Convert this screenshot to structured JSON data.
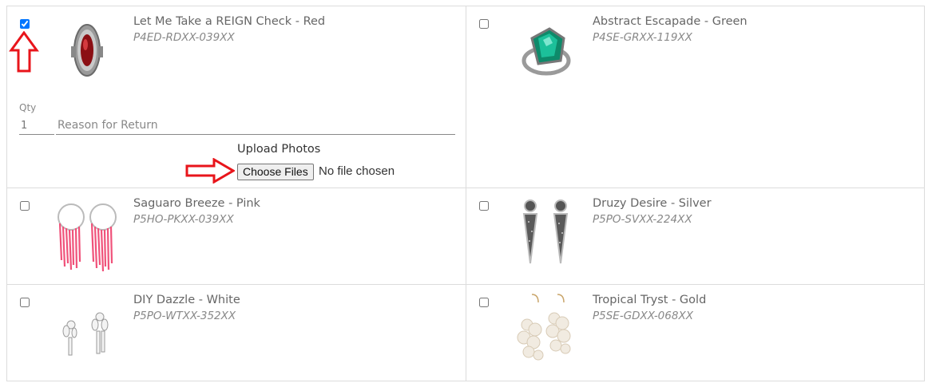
{
  "products": [
    {
      "name": "Let Me Take a REIGN Check - Red",
      "sku": "P4ED-RDXX-039XX",
      "checked": true,
      "image_icon": "red-marquise-ring-icon"
    },
    {
      "name": "Abstract Escapade - Green",
      "sku": "P4SE-GRXX-119XX",
      "checked": false,
      "image_icon": "green-gem-ring-icon"
    },
    {
      "name": "Saguaro Breeze - Pink",
      "sku": "P5HO-PKXX-039XX",
      "checked": false,
      "image_icon": "pink-fringe-hoop-earrings-icon"
    },
    {
      "name": "Druzy Desire - Silver",
      "sku": "P5PO-SVXX-224XX",
      "checked": false,
      "image_icon": "silver-druzy-earrings-icon"
    },
    {
      "name": "DIY Dazzle - White",
      "sku": "P5PO-WTXX-352XX",
      "checked": false,
      "image_icon": "white-drop-earrings-icon"
    },
    {
      "name": "Tropical Tryst - Gold",
      "sku": "P5SE-GDXX-068XX",
      "checked": false,
      "image_icon": "gold-shell-cluster-earrings-icon"
    }
  ],
  "return_form": {
    "qty_label": "Qty",
    "qty_value": "1",
    "reason_placeholder": "Reason for Return",
    "upload_title": "Upload Photos",
    "choose_files_label": "Choose Files",
    "file_status": "No file chosen"
  },
  "annotations": {
    "arrow_color": "#e8151b",
    "items": [
      "up-arrow-annotation-icon",
      "right-arrow-annotation-icon"
    ]
  }
}
